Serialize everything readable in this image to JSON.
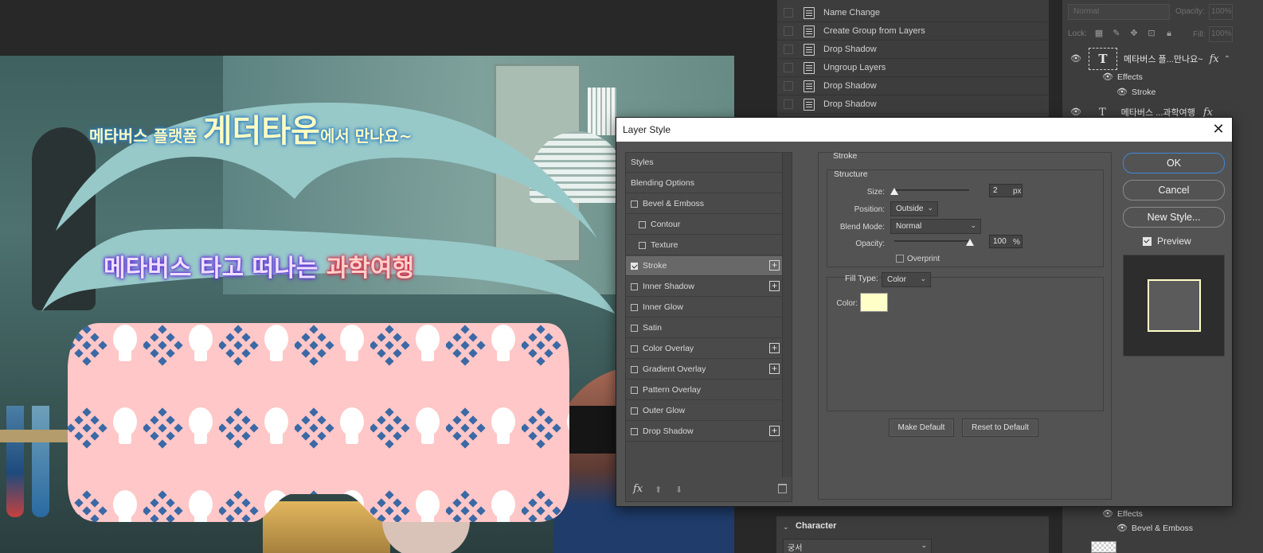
{
  "canvas": {
    "headline1_pre": "메타버스 플랫폼 ",
    "headline1_big": "게더타운",
    "headline1_post": "에서 만나요~",
    "headline2_main": "메타버스 타고 떠나는 ",
    "headline2_warm": "과학여행"
  },
  "history": {
    "items": [
      "Name Change",
      "Create Group from Layers",
      "Drop Shadow",
      "Ungroup Layers",
      "Drop Shadow",
      "Drop Shadow"
    ]
  },
  "layers": {
    "blend_mode": "Normal",
    "opacity_label": "Opacity:",
    "opacity_value": "100%",
    "lock_label": "Lock:",
    "fill_label": "Fill:",
    "fill_value": "100%",
    "layer1_name": "메타버스 플...만나요~",
    "layer1_thumb": "T",
    "effects_label": "Effects",
    "stroke_label": "Stroke",
    "layer2_name": "메타버스 ...과학여행",
    "effects2_label": "Effects",
    "bevel_label": "Bevel & Emboss"
  },
  "character": {
    "title": "Character",
    "font_value": "궁서"
  },
  "dialog": {
    "title": "Layer Style",
    "styles_header": "Styles",
    "blending_options": "Blending Options",
    "styles": [
      {
        "label": "Bevel & Emboss"
      },
      {
        "label": "Contour"
      },
      {
        "label": "Texture"
      },
      {
        "label": "Stroke"
      },
      {
        "label": "Inner Shadow"
      },
      {
        "label": "Inner Glow"
      },
      {
        "label": "Satin"
      },
      {
        "label": "Color Overlay"
      },
      {
        "label": "Gradient Overlay"
      },
      {
        "label": "Pattern Overlay"
      },
      {
        "label": "Outer Glow"
      },
      {
        "label": "Drop Shadow"
      }
    ],
    "footer_fx": "fx",
    "section_title": "Stroke",
    "structure_title": "Structure",
    "size_label": "Size:",
    "size_value": "2",
    "size_unit": "px",
    "position_label": "Position:",
    "position_value": "Outside",
    "blend_mode_label": "Blend Mode:",
    "blend_mode_value": "Normal",
    "opacity_label": "Opacity:",
    "opacity_value": "100",
    "opacity_unit": "%",
    "overprint_label": "Overprint",
    "fill_type_label": "Fill Type:",
    "fill_type_value": "Color",
    "color_label": "Color:",
    "stroke_color": "#ffffc8",
    "make_default": "Make Default",
    "reset_default": "Reset to Default",
    "ok": "OK",
    "cancel": "Cancel",
    "new_style": "New Style...",
    "preview_label": "Preview"
  }
}
